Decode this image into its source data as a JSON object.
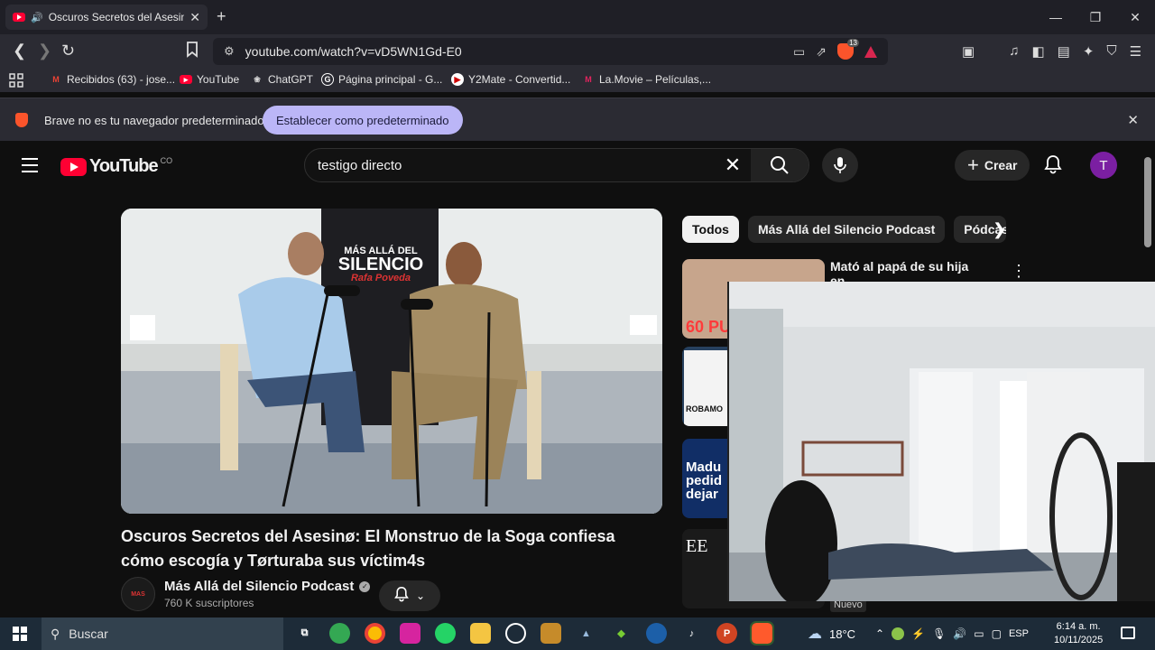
{
  "browser": {
    "tab_title": "Oscuros Secretos del Asesinø: El Monstruo de la Soga",
    "url": "youtube.com/watch?v=vD5WN1Gd-E0",
    "shield_count": "13",
    "bookmarks": [
      {
        "label": "Recibidos (63) - jose...",
        "icon": "gmail-icon"
      },
      {
        "label": "YouTube",
        "icon": "youtube-icon"
      },
      {
        "label": "ChatGPT",
        "icon": "chatgpt-icon"
      },
      {
        "label": "Página principal - G...",
        "icon": "google-icon"
      },
      {
        "label": "Y2Mate - Convertid...",
        "icon": "y2mate-icon"
      },
      {
        "label": "La.Movie – Películas,...",
        "icon": "lamovie-icon"
      }
    ],
    "infobar": {
      "message": "Brave no es tu navegador predeterminado",
      "button": "Establecer como predeterminado"
    },
    "colors": {
      "accent": "#bbb6f7",
      "brave": "#fb542b",
      "youtube_red": "#ff0033"
    }
  },
  "youtube": {
    "logo_text": "YouTube",
    "country_code": "CO",
    "search_query": "testigo directo",
    "create_label": "Crear",
    "avatar_letter": "T",
    "video": {
      "title": "Oscuros Secretos del Asesinø: El Monstruo de la Soga confiesa cómo escogía y Tørturaba sus víctim4s",
      "channel": "Más Allá del Silencio Podcast",
      "subscribers": "760 K suscriptores",
      "banner_line1": "MÁS ALLÁ DEL",
      "banner_line2": "SILENCIO",
      "banner_line3": "Rafa Poveda"
    },
    "chips": [
      "Todos",
      "Más Allá del Silencio Podcast",
      "Pódcasts"
    ],
    "related": [
      {
        "title": "Mató al papá de su hija en",
        "thumb_text": "60 PU"
      },
      {
        "thumb_text": "ROBAMO"
      },
      {
        "thumb_text": "Madu pedid dejar"
      },
      {
        "thumb_text": "EE"
      }
    ],
    "new_badge": "Nuevo"
  },
  "taskbar": {
    "search_placeholder": "Buscar",
    "temperature": "18°C",
    "language": "ESP",
    "time": "6:14 a. m.",
    "date": "10/11/2025"
  }
}
